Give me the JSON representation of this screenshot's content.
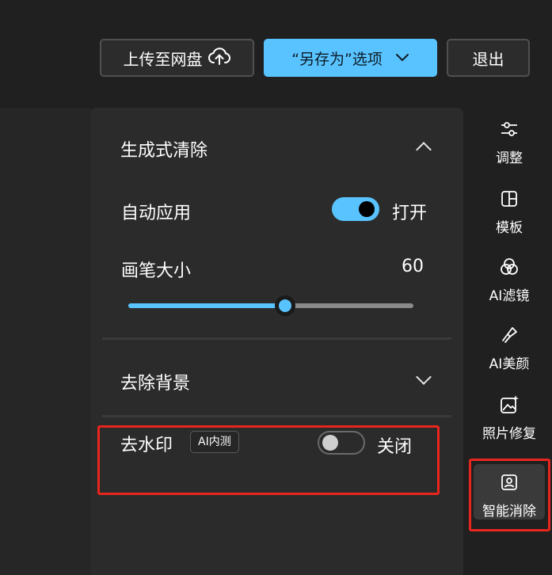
{
  "toolbar": {
    "upload_label": "上传至网盘",
    "upload_icon": "cloud-upload-icon",
    "save_as_label": "“另存为”选项",
    "save_as_icon": "chevron-down-icon",
    "exit_label": "退出"
  },
  "panel": {
    "generative_erase": {
      "title": "生成式清除",
      "expanded": true,
      "auto_apply": {
        "label": "自动应用",
        "state_label": "打开",
        "on": true
      },
      "brush_size": {
        "label": "画笔大小",
        "value": "60",
        "fraction": 0.55
      }
    },
    "remove_background": {
      "title": "去除背景",
      "expanded": false
    },
    "remove_watermark": {
      "label": "去水印",
      "badge": "AI内测",
      "state_label": "关闭",
      "on": false
    }
  },
  "rail": {
    "items": [
      {
        "label": "调整",
        "icon": "sliders-icon"
      },
      {
        "label": "模板",
        "icon": "template-icon"
      },
      {
        "label": "AI滤镜",
        "icon": "ai-filter-icon"
      },
      {
        "label": "AI美颜",
        "icon": "ai-beauty-icon"
      },
      {
        "label": "照片修复",
        "icon": "photo-repair-icon"
      },
      {
        "label": "智能消除",
        "icon": "smart-erase-icon",
        "active": true
      }
    ]
  },
  "colors": {
    "accent": "#59c3ff",
    "highlight": "#e8261d",
    "panel_bg": "#2b2b2b",
    "app_bg": "#202020"
  }
}
